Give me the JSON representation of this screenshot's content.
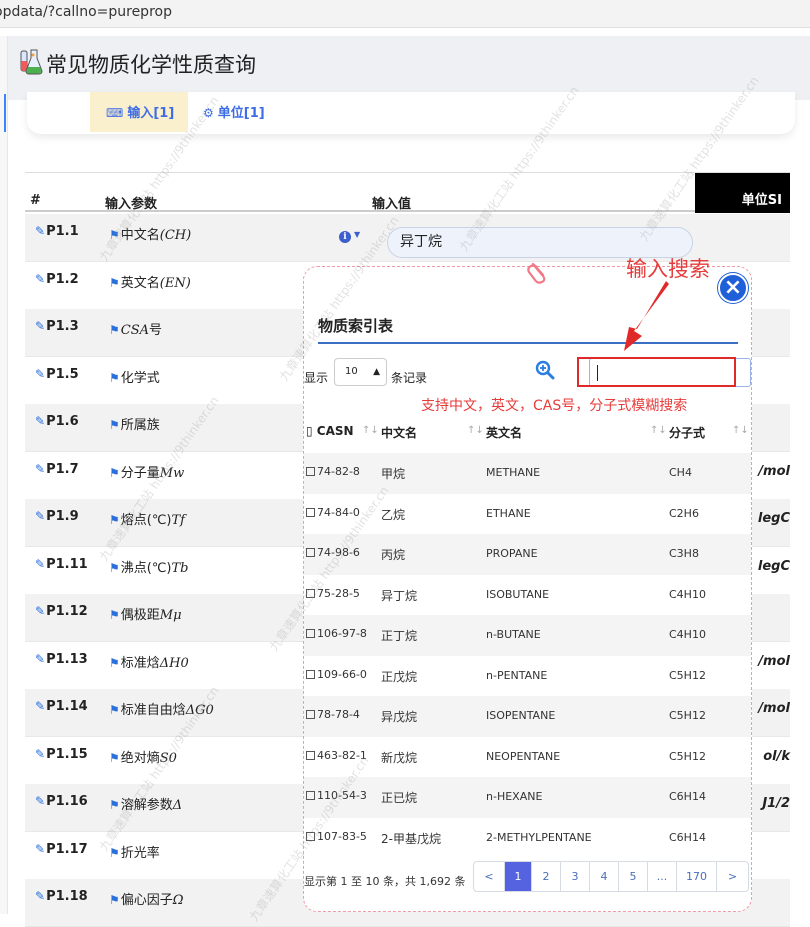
{
  "browser": {
    "url": "opdata/?callno=pureprop"
  },
  "header": {
    "title": "常见物质化学性质查询"
  },
  "tabs": [
    {
      "label": "输入[1]",
      "icon": "keyboard-icon"
    },
    {
      "label": "单位[1]",
      "icon": "cogs-icon"
    }
  ],
  "params_table": {
    "columns": [
      "#",
      "输入参数",
      "输入值",
      "单位SI"
    ],
    "rows": [
      {
        "id": "P1.1",
        "name_text": "中文名",
        "name_math": "(CH)",
        "unit": ""
      },
      {
        "id": "P1.2",
        "name_text": "英文名",
        "name_math": "(EN)",
        "unit": ""
      },
      {
        "id": "P1.3",
        "name_text": "",
        "name_math": "CSA",
        "name_suffix": "号",
        "unit": ""
      },
      {
        "id": "P1.5",
        "name_text": "化学式",
        "name_math": "",
        "unit": ""
      },
      {
        "id": "P1.6",
        "name_text": "所属族",
        "name_math": "",
        "unit": ""
      },
      {
        "id": "P1.7",
        "name_text": "分子量",
        "name_math": "Mw",
        "unit": "/mol"
      },
      {
        "id": "P1.9",
        "name_text": "熔点(℃)",
        "name_math": "Tf",
        "unit": "legC"
      },
      {
        "id": "P1.11",
        "name_text": "沸点(℃)",
        "name_math": "Tb",
        "unit": "legC"
      },
      {
        "id": "P1.12",
        "name_text": "偶极距",
        "name_math": "Mμ",
        "unit": ""
      },
      {
        "id": "P1.13",
        "name_text": "标准焓",
        "name_math": "ΔH0",
        "unit": "/mol"
      },
      {
        "id": "P1.14",
        "name_text": "标准自由焓",
        "name_math": "ΔG0",
        "unit": "/mol"
      },
      {
        "id": "P1.15",
        "name_text": "绝对熵",
        "name_math": "S0",
        "unit": "ol/k"
      },
      {
        "id": "P1.16",
        "name_text": "溶解参数",
        "name_math": "Δ",
        "unit": "J1/2"
      },
      {
        "id": "P1.17",
        "name_text": "折光率",
        "name_math": "",
        "unit": ""
      },
      {
        "id": "P1.18",
        "name_text": "偏心因子",
        "name_math": "Ω",
        "unit": ""
      }
    ],
    "input_value": "异丁烷"
  },
  "modal": {
    "title": "物质索引表",
    "show_label": "显示",
    "page_length": "10",
    "records_label": "条记录",
    "search_value": "",
    "columns": [
      "CASN",
      "中文名",
      "英文名",
      "分子式"
    ],
    "rows": [
      {
        "cas": "74-82-8",
        "cn": "甲烷",
        "en": "METHANE",
        "formula": "CH4"
      },
      {
        "cas": "74-84-0",
        "cn": "乙烷",
        "en": "ETHANE",
        "formula": "C2H6"
      },
      {
        "cas": "74-98-6",
        "cn": "丙烷",
        "en": "PROPANE",
        "formula": "C3H8"
      },
      {
        "cas": "75-28-5",
        "cn": "异丁烷",
        "en": "ISOBUTANE",
        "formula": "C4H10"
      },
      {
        "cas": "106-97-8",
        "cn": "正丁烷",
        "en": "n-BUTANE",
        "formula": "C4H10"
      },
      {
        "cas": "109-66-0",
        "cn": "正戊烷",
        "en": "n-PENTANE",
        "formula": "C5H12"
      },
      {
        "cas": "78-78-4",
        "cn": "异戊烷",
        "en": "ISOPENTANE",
        "formula": "C5H12"
      },
      {
        "cas": "463-82-1",
        "cn": "新戊烷",
        "en": "NEOPENTANE",
        "formula": "C5H12"
      },
      {
        "cas": "110-54-3",
        "cn": "正已烷",
        "en": "n-HEXANE",
        "formula": "C6H14"
      },
      {
        "cas": "107-83-5",
        "cn": "2-甲基戊烷",
        "en": "2-METHYLPENTANE",
        "formula": "C6H14"
      }
    ],
    "info": "显示第 1 至 10 条，共 1,692 条",
    "pager": [
      "<",
      "1",
      "2",
      "3",
      "4",
      "5",
      "...",
      "170",
      ">"
    ],
    "pager_active": "1"
  },
  "annotations": {
    "search_label": "输入搜索",
    "search_hint": "支持中文，英文，CAS号，分子式模糊搜索"
  },
  "watermark": {
    "text": "九章速算化工站 https://9thinker.cn"
  },
  "colors": {
    "accent": "#3d6ce6",
    "annotation": "#e63b3b",
    "pager_active": "#5563e0",
    "modal_border": "#f19aa8"
  }
}
